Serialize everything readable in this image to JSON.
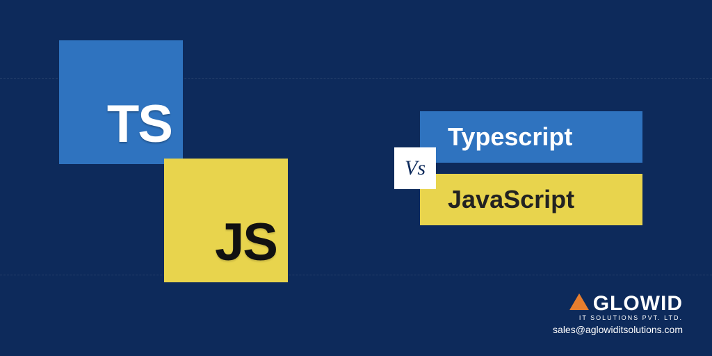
{
  "tiles": {
    "ts": "TS",
    "js": "JS"
  },
  "labels": {
    "typescript": "Typescript",
    "javascript": "JavaScript",
    "vs": "Vs"
  },
  "brand": {
    "name": "GLOWID",
    "subtitle": "IT SOLUTIONS PVT. LTD.",
    "email": "sales@aglowiditsolutions.com"
  }
}
